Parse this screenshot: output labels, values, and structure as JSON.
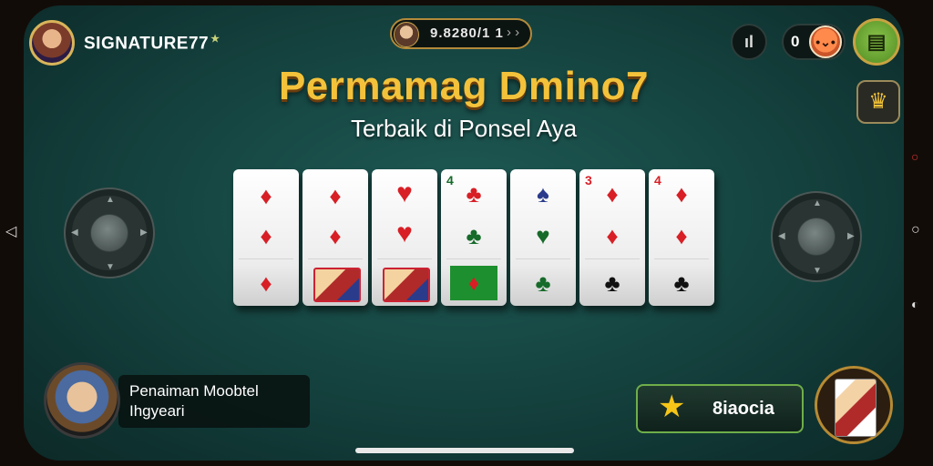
{
  "header": {
    "username": "SIGNATURE77",
    "coin_value": "9.8280/1 1",
    "coin_arrows": "› ›",
    "stats_icon": "bar-chart-icon",
    "zero_count": "0",
    "menu_icon": "menu-grid-icon",
    "gift_icon": "gift-icon"
  },
  "title": {
    "main": "Permamag Dmino7",
    "sub": "Terbaik di Ponsel Aya"
  },
  "tiles": [
    {
      "top": "♦",
      "mid": "♦",
      "bottom": "♦"
    },
    {
      "top": "♦",
      "mid": "♦",
      "bottom": ""
    },
    {
      "top": "♥",
      "mid": "♥",
      "bottom": ""
    },
    {
      "top": "♣",
      "mid": "♣",
      "bottom": "♦"
    },
    {
      "top": "♠",
      "mid": "♥",
      "bottom": "♣"
    },
    {
      "top": "♦",
      "mid": "♦",
      "bottom": "♣"
    },
    {
      "top": "♦",
      "mid": "♦",
      "bottom": "♣"
    }
  ],
  "player": {
    "line1": "Penaiman Moobtel",
    "line2": "Ihgyeari"
  },
  "star_button": {
    "label": "8iaocia"
  }
}
